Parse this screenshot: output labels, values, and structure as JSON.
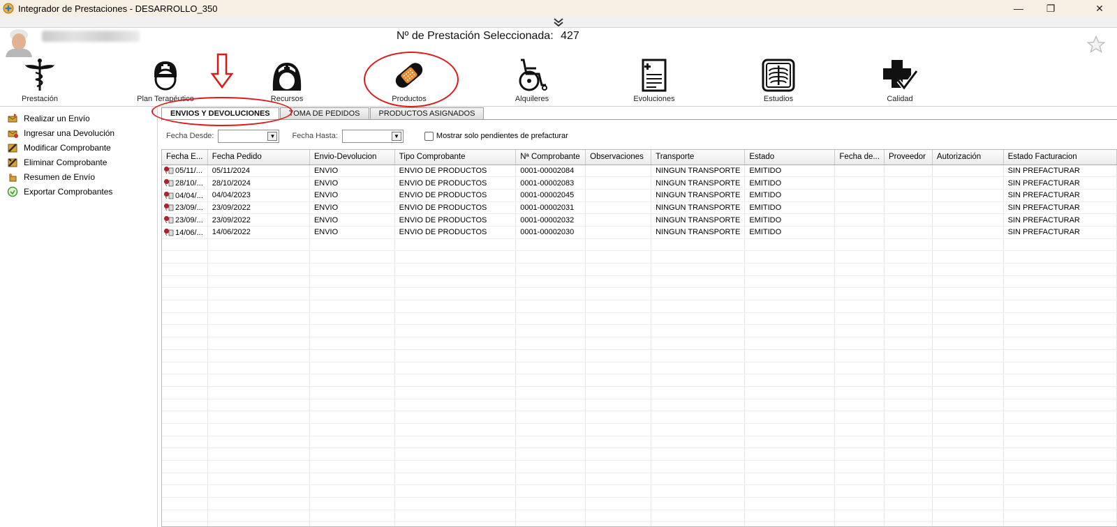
{
  "window": {
    "title": "Integrador de Prestaciones - DESARROLLO_350",
    "minimize": "—",
    "restore": "❐",
    "close": "✕"
  },
  "header": {
    "prestacion_label": "Nº de Prestación Seleccionada:",
    "prestacion_number": "427"
  },
  "nav": [
    {
      "label": "Prestación",
      "icon": "caduceus-icon"
    },
    {
      "label": "Plan Terapéutico",
      "icon": "nurse-icon"
    },
    {
      "label": "Recursos",
      "icon": "nurse-female-icon"
    },
    {
      "label": "Productos",
      "icon": "bandage-icon"
    },
    {
      "label": "Alquileres",
      "icon": "wheelchair-icon"
    },
    {
      "label": "Evoluciones",
      "icon": "medical-report-icon"
    },
    {
      "label": "Estudios",
      "icon": "xray-icon"
    },
    {
      "label": "Calidad",
      "icon": "quality-cross-icon"
    }
  ],
  "sidebar": {
    "items": [
      {
        "label": "Realizar un Envío"
      },
      {
        "label": "Ingresar una Devolución"
      },
      {
        "label": "Modificar Comprobante"
      },
      {
        "label": "Eliminar Comprobante"
      },
      {
        "label": "Resumen de Envío"
      },
      {
        "label": "Exportar Comprobantes"
      }
    ]
  },
  "tabs": [
    {
      "label": "ENVIOS Y DEVOLUCIONES",
      "active": true
    },
    {
      "label": "TOMA DE PEDIDOS",
      "active": false
    },
    {
      "label": "PRODUCTOS ASIGNADOS",
      "active": false
    }
  ],
  "filters": {
    "desde_label": "Fecha Desde:",
    "hasta_label": "Fecha Hasta:",
    "desde_value": "",
    "hasta_value": "",
    "checkbox_label": "Mostrar solo pendientes de prefacturar",
    "checkbox_checked": false
  },
  "table": {
    "columns": [
      "Fecha E...",
      "Fecha Pedido",
      "Envio-Devolucion",
      "Tipo Comprobante",
      "Nª Comprobante",
      "Observaciones",
      "Transporte",
      "Estado",
      "Fecha de...",
      "Proveedor",
      "Autorización",
      "Estado Facturacion"
    ],
    "rows": [
      [
        "05/11/...",
        "05/11/2024",
        "ENVIO",
        "ENVIO DE PRODUCTOS",
        "0001-00002084",
        "",
        "NINGUN TRANSPORTE",
        "EMITIDO",
        "",
        "",
        "",
        "SIN PREFACTURAR"
      ],
      [
        "28/10/...",
        "28/10/2024",
        "ENVIO",
        "ENVIO DE PRODUCTOS",
        "0001-00002083",
        "",
        "NINGUN TRANSPORTE",
        "EMITIDO",
        "",
        "",
        "",
        "SIN PREFACTURAR"
      ],
      [
        "04/04/...",
        "04/04/2023",
        "ENVIO",
        "ENVIO DE PRODUCTOS",
        "0001-00002045",
        "",
        "NINGUN TRANSPORTE",
        "EMITIDO",
        "",
        "",
        "",
        "SIN PREFACTURAR"
      ],
      [
        "23/09/...",
        "23/09/2022",
        "ENVIO",
        "ENVIO DE PRODUCTOS",
        "0001-00002031",
        "",
        "NINGUN TRANSPORTE",
        "EMITIDO",
        "",
        "",
        "",
        "SIN PREFACTURAR"
      ],
      [
        "23/09/...",
        "23/09/2022",
        "ENVIO",
        "ENVIO DE PRODUCTOS",
        "0001-00002032",
        "",
        "NINGUN TRANSPORTE",
        "EMITIDO",
        "",
        "",
        "",
        "SIN PREFACTURAR"
      ],
      [
        "14/06/...",
        "14/06/2022",
        "ENVIO",
        "ENVIO DE PRODUCTOS",
        "0001-00002030",
        "",
        "NINGUN TRANSPORTE",
        "EMITIDO",
        "",
        "",
        "",
        "SIN PREFACTURAR"
      ]
    ]
  },
  "colors": {
    "annotation_red": "#e01818",
    "title_bar": "#f7efe3"
  }
}
